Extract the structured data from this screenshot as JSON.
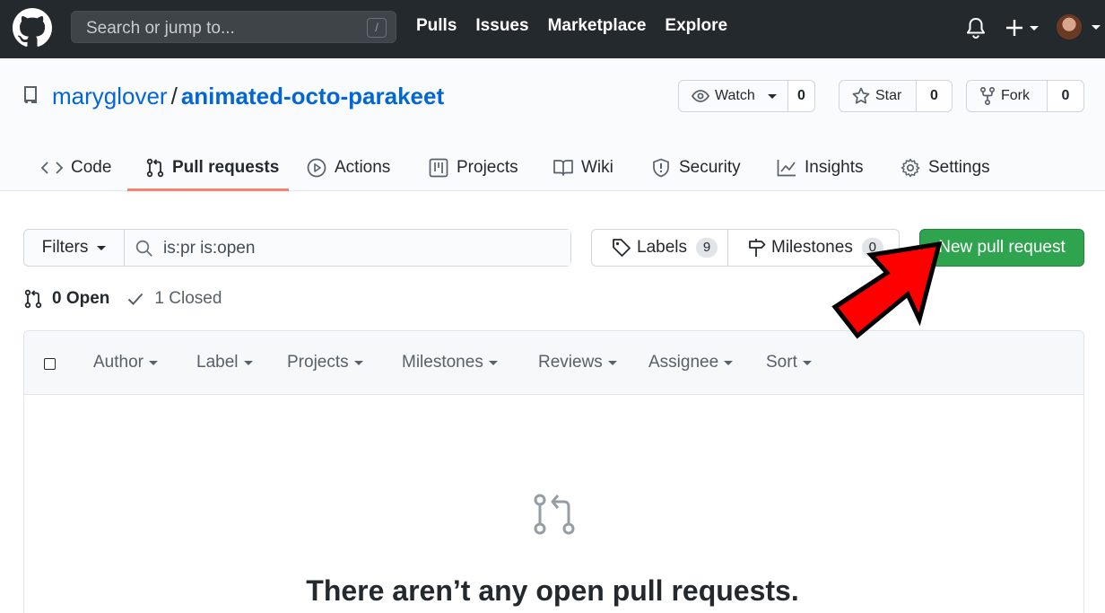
{
  "topnav": {
    "search_placeholder": "Search or jump to...",
    "search_shortcut": "/",
    "links": [
      "Pulls",
      "Issues",
      "Marketplace",
      "Explore"
    ]
  },
  "repo": {
    "owner": "maryglover",
    "separator": "/",
    "name": "animated-octo-parakeet",
    "watch_label": "Watch",
    "watch_count": "0",
    "star_label": "Star",
    "star_count": "0",
    "fork_label": "Fork",
    "fork_count": "0"
  },
  "tabs": [
    {
      "label": "Code",
      "icon": "code-icon"
    },
    {
      "label": "Pull requests",
      "icon": "git-pull-request-icon",
      "active": true
    },
    {
      "label": "Actions",
      "icon": "play-icon"
    },
    {
      "label": "Projects",
      "icon": "project-icon"
    },
    {
      "label": "Wiki",
      "icon": "book-icon"
    },
    {
      "label": "Security",
      "icon": "shield-icon"
    },
    {
      "label": "Insights",
      "icon": "graph-icon"
    },
    {
      "label": "Settings",
      "icon": "gear-icon"
    }
  ],
  "filters": {
    "button_label": "Filters",
    "query": "is:pr is:open",
    "labels_label": "Labels",
    "labels_count": "9",
    "milestones_label": "Milestones",
    "milestones_count": "0",
    "new_pr_label": "New pull request"
  },
  "states": {
    "open": "0 Open",
    "closed": "1 Closed"
  },
  "list_header": [
    "Author",
    "Label",
    "Projects",
    "Milestones",
    "Reviews",
    "Assignee",
    "Sort"
  ],
  "empty_state": {
    "title": "There aren’t any open pull requests."
  },
  "colors": {
    "accent": "#0366d6",
    "primary_button": "#2ea44f",
    "tab_underline": "#f9826c",
    "annotation_arrow": "#ff0000"
  }
}
